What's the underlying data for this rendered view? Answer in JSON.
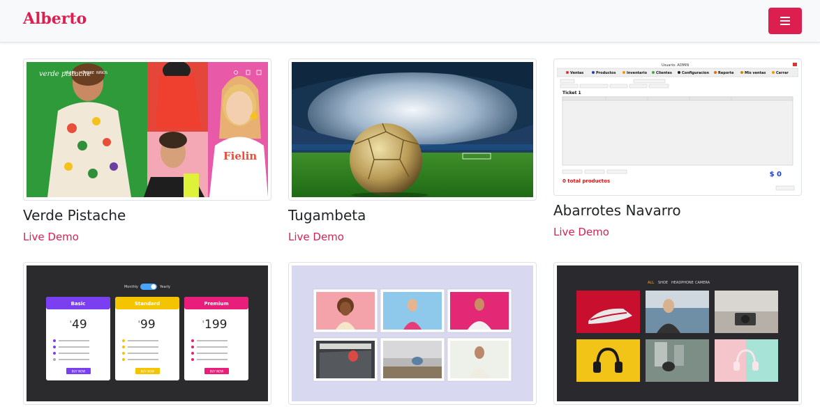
{
  "navbar": {
    "brand": "Alberto",
    "menu_icon": "hamburger-icon",
    "accent_color": "#dc1f4f"
  },
  "projects": [
    {
      "title": "Verde Pistache",
      "link_label": "Live Demo",
      "thumb": {
        "logo": "verde pistache",
        "menu": [
          "MUJER",
          "HOMBRE",
          "NIÑOS"
        ],
        "shirt_text": "Fielin"
      }
    },
    {
      "title": "Tugambeta",
      "link_label": "Live Demo",
      "thumb": {}
    },
    {
      "title": "Abarrotes Navarro",
      "link_label": "Live Demo",
      "thumb": {
        "window_title": "Usuario: ADMIN",
        "tabs": [
          "Ventas",
          "Productos",
          "Inventario",
          "Clientes",
          "Configuracion",
          "Reporte",
          "Mis ventas",
          "Cerrar"
        ],
        "ticket": "Ticket 1",
        "total_amount": "$ 0",
        "total_products": "0 total productos"
      }
    },
    {
      "title": "",
      "link_label": "",
      "thumb": {
        "toggle_left": "Monthly",
        "toggle_right": "Yearly",
        "plans": [
          {
            "name": "Basic",
            "price": "49",
            "color": "#7b3ff2",
            "button": "BUY NOW"
          },
          {
            "name": "Standard",
            "price": "99",
            "color": "#f5c400",
            "button": "BUY NOW"
          },
          {
            "name": "Premium",
            "price": "199",
            "color": "#e91e7a",
            "button": "BUY NOW"
          }
        ]
      }
    },
    {
      "title": "",
      "link_label": "",
      "thumb": {}
    },
    {
      "title": "",
      "link_label": "",
      "thumb": {
        "filters": [
          "ALL",
          "SHOE",
          "HEADPHONE",
          "CAMERA"
        ]
      }
    }
  ]
}
